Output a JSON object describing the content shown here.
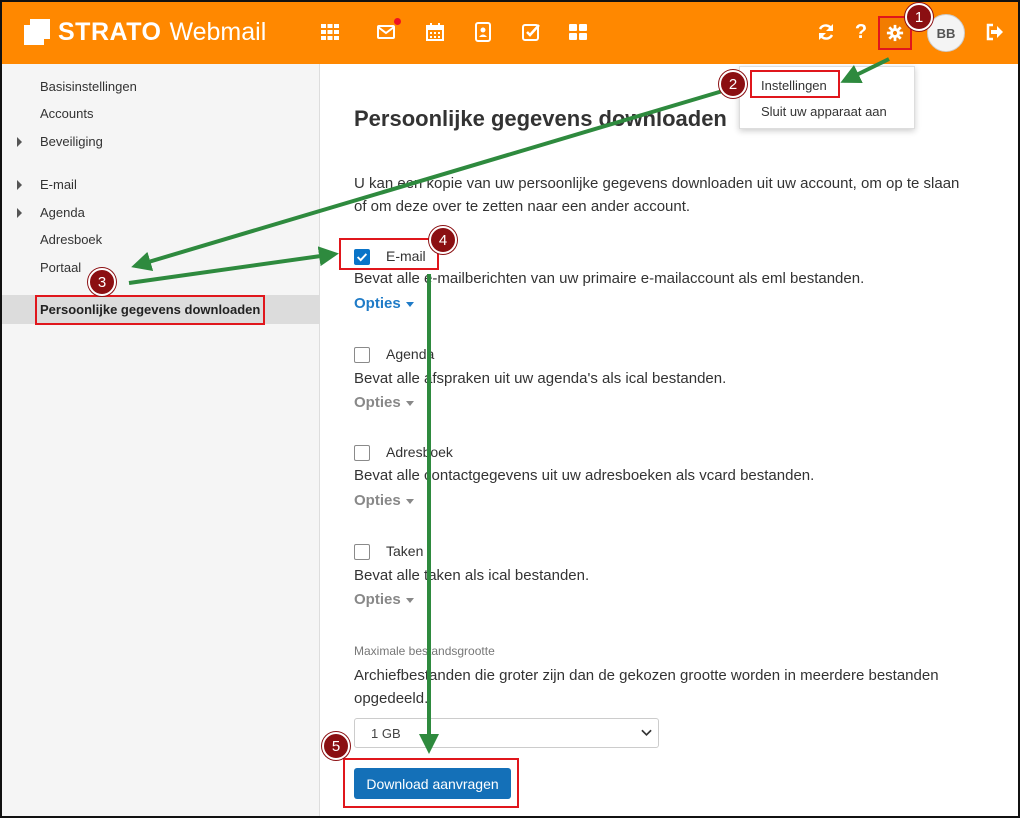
{
  "header": {
    "brand": "STRATO",
    "product": "Webmail",
    "icons": [
      "apps-grid-icon",
      "mail-icon",
      "calendar-icon",
      "contacts-icon",
      "tasks-icon",
      "portal-icon"
    ],
    "help_label": "?",
    "avatar_initials": "BB",
    "accent_color": "#ff8800"
  },
  "dropdown": {
    "items": [
      "Instellingen",
      "Sluit uw apparaat aan"
    ]
  },
  "sidebar": {
    "items": [
      {
        "label": "Basisinstellingen"
      },
      {
        "label": "Accounts"
      },
      {
        "label": "Beveiliging"
      },
      {
        "label": "E-mail"
      },
      {
        "label": "Agenda"
      },
      {
        "label": "Adresboek"
      },
      {
        "label": "Portaal"
      }
    ],
    "active_label": "Persoonlijke gegevens downloaden"
  },
  "main": {
    "title": "Persoonlijke gegevens downloaden",
    "intro": "U kan een kopie van uw persoonlijke gegevens downloaden uit uw account, om op te slaan of om deze over te zetten naar een ander account.",
    "sections": [
      {
        "label": "E-mail",
        "checked": true,
        "description": "Bevat alle e-mailberichten van uw primaire e-mailaccount als eml bestanden.",
        "options_label": "Opties"
      },
      {
        "label": "Agenda",
        "checked": false,
        "description": "Bevat alle afspraken uit uw agenda's als ical bestanden.",
        "options_label": "Opties"
      },
      {
        "label": "Adresboek",
        "checked": false,
        "description": "Bevat alle contactgegevens uit uw adresboeken als vcard bestanden.",
        "options_label": "Opties"
      },
      {
        "label": "Taken",
        "checked": false,
        "description": "Bevat alle taken als ical bestanden.",
        "options_label": "Opties"
      }
    ],
    "max_size_label": "Maximale bestandsgrootte",
    "max_size_description": "Archiefbestanden die groter zijn dan de gekozen grootte worden in meerdere bestanden opgedeeld.",
    "max_size_value": "1 GB",
    "download_button": "Download aanvragen"
  },
  "annotations": {
    "step_numbers": [
      "1",
      "2",
      "3",
      "4",
      "5"
    ],
    "box_color": "#e0161c",
    "arrow_color": "#2e8a3e",
    "badge_color": "#8b0f12"
  }
}
